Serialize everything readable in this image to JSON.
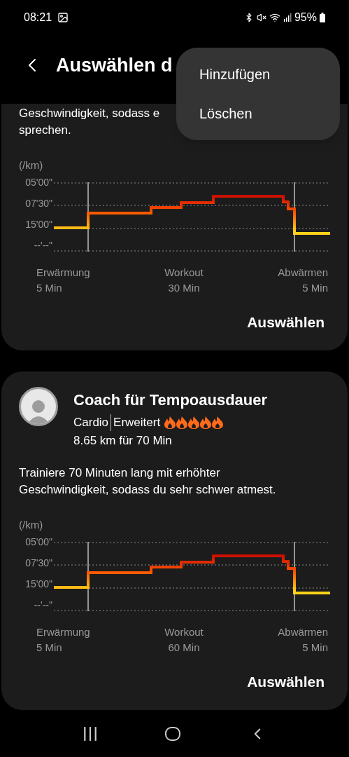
{
  "status_bar": {
    "time": "08:21",
    "battery": "95%"
  },
  "header": {
    "title": "Auswählen d"
  },
  "menu": [
    {
      "label": "Hinzufügen"
    },
    {
      "label": "Löschen"
    }
  ],
  "cards": [
    {
      "description": "Geschwindigkeit, sodass e\nsprechen.",
      "chart": {
        "unit": "(/km)",
        "ticks": [
          "05'00\"",
          "07'30\"",
          "15'00\"",
          "--'--\""
        ],
        "phases": [
          {
            "name": "Erwärmung",
            "duration": "5 Min"
          },
          {
            "name": "Workout",
            "duration": "30 Min"
          },
          {
            "name": "Abwärmen",
            "duration": "5 Min"
          }
        ]
      },
      "button": "Auswählen"
    },
    {
      "title": "Coach für Tempoausdauer",
      "category": "Cardio",
      "level": "Erweitert",
      "stars": 5,
      "distance": "8.65 km für 70 Min",
      "description": "Trainiere 70 Minuten lang mit erhöhter\nGeschwindigkeit, sodass du sehr schwer atmest.",
      "chart": {
        "unit": "(/km)",
        "ticks": [
          "05'00\"",
          "07'30\"",
          "15'00\"",
          "--'--\""
        ],
        "phases": [
          {
            "name": "Erwärmung",
            "duration": "5 Min"
          },
          {
            "name": "Workout",
            "duration": "60 Min"
          },
          {
            "name": "Abwärmen",
            "duration": "5 Min"
          }
        ]
      },
      "button": "Auswählen"
    }
  ]
}
